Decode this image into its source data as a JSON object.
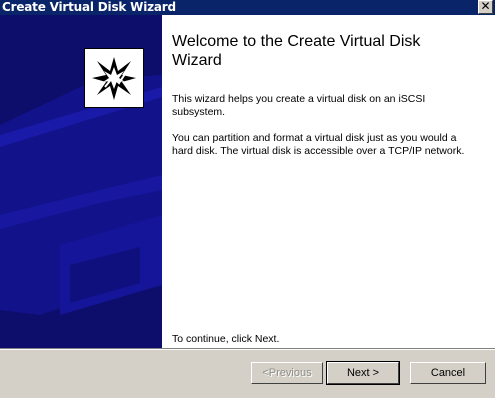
{
  "window": {
    "title": "Create Virtual Disk Wizard",
    "close_glyph": "✕"
  },
  "content": {
    "heading": "Welcome to the Create Virtual Disk Wizard",
    "paragraph1": "This wizard helps you create a virtual disk on an iSCSI subsystem.",
    "paragraph2": "You can partition and format a virtual disk just as you would a hard disk. The virtual disk is accessible over a TCP/IP network.",
    "continue_note": "To continue, click Next."
  },
  "buttons": {
    "previous": "<Previous",
    "next": "Next >",
    "cancel": "Cancel"
  },
  "colors": {
    "title_bar": "#0a246a",
    "side_panel": "#0d0d6b",
    "side_panel_accent": "#1a1aa8"
  }
}
